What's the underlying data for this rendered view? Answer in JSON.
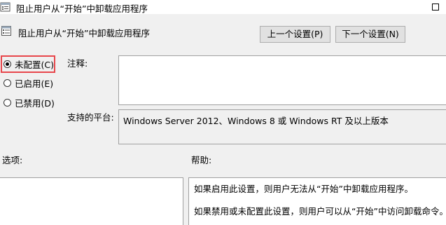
{
  "window": {
    "title": "阻止用户从“开始”中卸载应用程序"
  },
  "header": {
    "title": "阻止用户从“开始”中卸载应用程序",
    "prev_button": "上一个设置(P)",
    "next_button": "下一个设置(N)"
  },
  "state": {
    "options": [
      {
        "label": "未配置(C)",
        "checked": true
      },
      {
        "label": "已启用(E)",
        "checked": false
      },
      {
        "label": "已禁用(D)",
        "checked": false
      }
    ]
  },
  "comment": {
    "label": "注释:",
    "value": ""
  },
  "platform": {
    "label": "支持的平台:",
    "value": "Windows Server 2012、Windows 8 或 Windows RT 及以上版本"
  },
  "options_section": {
    "label": "选项:"
  },
  "help_section": {
    "label": "帮助:",
    "lines": [
      "如果启用此设置，则用户无法从“开始”中卸载应用程序。",
      "如果禁用或未配置此设置，则用户可以从“开始”中访问卸载命令。"
    ]
  },
  "colors": {
    "highlight": "#e8474c",
    "window_bg": "#f0f0f0"
  }
}
